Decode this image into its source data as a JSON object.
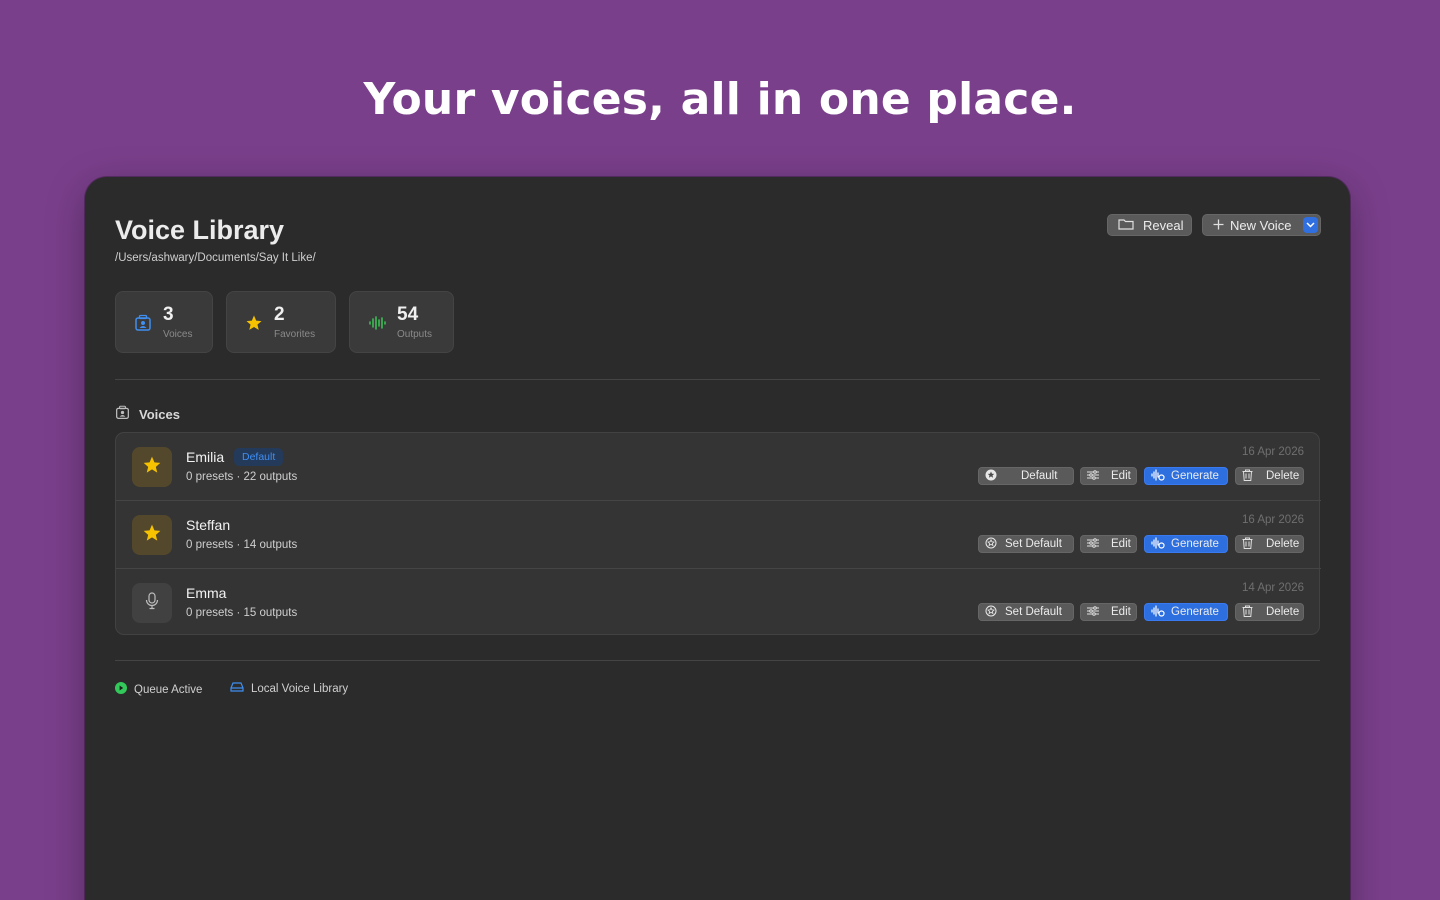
{
  "headline": "Your voices, all in one place.",
  "window": {
    "title": "Voice Library",
    "path": "/Users/ashwary/Documents/Say It Like/",
    "buttons": {
      "reveal": "Reveal",
      "new_voice": "New Voice"
    }
  },
  "stats": [
    {
      "value": "3",
      "label": "Voices",
      "icon": "person-card-icon"
    },
    {
      "value": "2",
      "label": "Favorites",
      "icon": "star-icon"
    },
    {
      "value": "54",
      "label": "Outputs",
      "icon": "waveform-icon"
    }
  ],
  "section": {
    "label": "Voices"
  },
  "voices": [
    {
      "name": "Emilia",
      "badge": "Default",
      "meta": "0 presets · 22 outputs",
      "date": "16 Apr 2026",
      "favorite": true,
      "default_label": "Default",
      "edit": "Edit",
      "generate": "Generate",
      "delete": "Delete"
    },
    {
      "name": "Steffan",
      "meta": "0 presets · 14 outputs",
      "date": "16 Apr 2026",
      "favorite": true,
      "default_label": "Set Default",
      "edit": "Edit",
      "generate": "Generate",
      "delete": "Delete"
    },
    {
      "name": "Emma",
      "meta": "0 presets · 15 outputs",
      "date": "14 Apr 2026",
      "favorite": false,
      "default_label": "Set Default",
      "edit": "Edit",
      "generate": "Generate",
      "delete": "Delete"
    }
  ],
  "status_bar": {
    "queue": "Queue Active",
    "library": "Local Voice Library"
  },
  "colors": {
    "background": "#7a3f8b",
    "window": "#2b2b2b",
    "accent": "#2e6fe0",
    "star": "#f7c300",
    "waveform": "#3ecf5a",
    "queue_dot": "#32c85a"
  }
}
